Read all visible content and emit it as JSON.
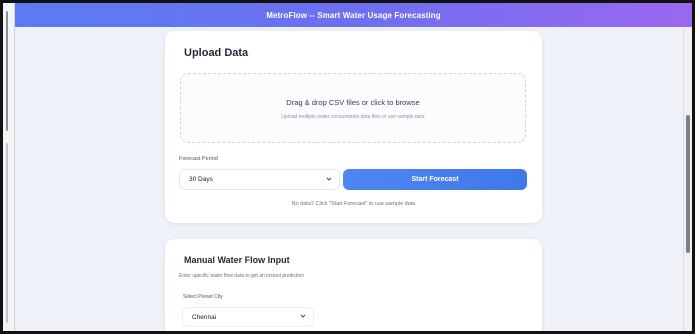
{
  "header": {
    "title": "MetroFlow -- Smart Water Usage Forecasting"
  },
  "upload": {
    "title": "Upload Data",
    "dropzone_main": "Drag & drop CSV files or click to browse",
    "dropzone_sub": "Upload multiple water consumption data files or use sample data",
    "period_label": "Forecast Period",
    "period_value": "30 Days",
    "start_button": "Start Forecast",
    "hint": "No data? Click \"Start Forecast\" to use sample data"
  },
  "manual": {
    "title": "Manual Water Flow Input",
    "subtitle": "Enter specific water flow data to get an instant prediction",
    "city_label": "Select Preset City",
    "city_value": "Chennai"
  },
  "colors": {
    "header_gradient_start": "#5b7cf0",
    "header_gradient_end": "#9a68ef",
    "primary_button": "#3f78ea",
    "page_background": "#eef1f8"
  },
  "icons": {
    "select_chevron": "chevron-down-icon"
  }
}
